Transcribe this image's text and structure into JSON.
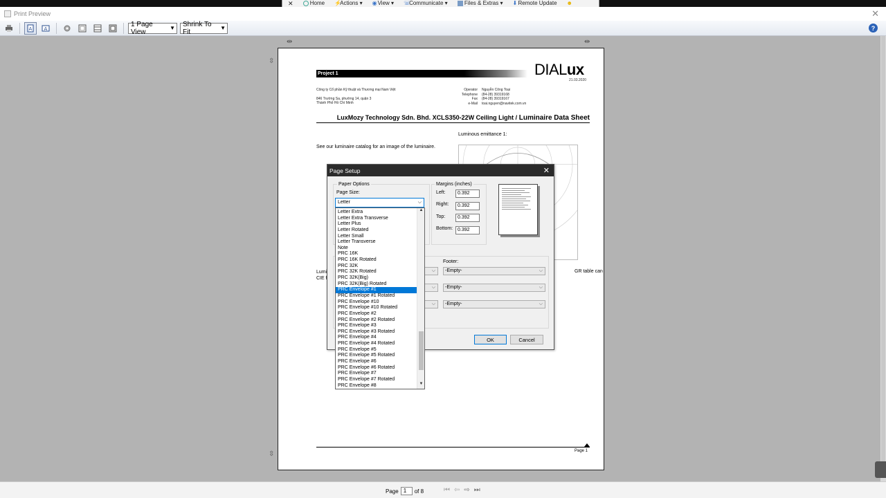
{
  "remote_toolbar": {
    "items": [
      "Home",
      "Actions",
      "View",
      "Communicate",
      "Files & Extras",
      "Remote Update"
    ]
  },
  "window": {
    "title": "Print Preview"
  },
  "toolbar": {
    "page_view": "1 Page View",
    "fit_mode": "Shrink To Fit",
    "help_label": "?"
  },
  "document": {
    "project_label": "Project 1",
    "logo_text": "DIAL",
    "logo_bold": "ux",
    "date": "21.03.2020",
    "company": "Công ty Cổ phần Kỹ thuật và Thương mại Nam Việt",
    "address_line1": "846 Trường Sa, phường 14, quận 3",
    "address_line2": "Thành Phố Hồ Chí Minh",
    "contact_labels": [
      "Operator",
      "Telephone",
      "Fax",
      "e-Mail"
    ],
    "contact_values": [
      "Nguyễn Công Toại",
      "(84-28) 39319168",
      "(84-28) 39319167",
      "toai.nguyen@navitek.com.vn"
    ],
    "heading": "LuxMozy Technology Sdn. Bhd. XCLS350-22W Ceiling Light /",
    "heading_tail": "Luminaire Data Sheet",
    "luminous_label": "Luminous emittance 1:",
    "see_catalog": "See our luminaire catalog for an image of the luminaire.",
    "left_fragment_1": "Lumi",
    "left_fragment_2": "CIE f",
    "right_fragment": "GR table can",
    "page_label": "Page 1"
  },
  "page_setup": {
    "title": "Page Setup",
    "paper_options": "Paper Options",
    "page_size_label": "Page Size:",
    "page_size_value": "Letter",
    "margins_label": "Margins (inches)",
    "margins": {
      "left_label": "Left:",
      "left": "0.392",
      "right_label": "Right:",
      "right": "0.392",
      "top_label": "Top:",
      "top": "0.392",
      "bottom_label": "Bottom:",
      "bottom": "0.392"
    },
    "footer_label": "Footer:",
    "header_values": [
      "",
      "",
      ""
    ],
    "footer_values": [
      "-Empty-",
      "-Empty-",
      "-Empty-"
    ],
    "ok": "OK",
    "cancel": "Cancel",
    "paper_sizes": [
      "Letter Extra",
      "Letter Extra Transverse",
      "Letter Plus",
      "Letter Rotated",
      "Letter Small",
      "Letter Transverse",
      "Note",
      "PRC 16K",
      "PRC 16K Rotated",
      "PRC 32K",
      "PRC 32K Rotated",
      "PRC 32K(Big)",
      "PRC 32K(Big) Rotated",
      "PRC Envelope #1",
      "PRC Envelope #1 Rotated",
      "PRC Envelope #10",
      "PRC Envelope #10 Rotated",
      "PRC Envelope #2",
      "PRC Envelope #2 Rotated",
      "PRC Envelope #3",
      "PRC Envelope #3 Rotated",
      "PRC Envelope #4",
      "PRC Envelope #4 Rotated",
      "PRC Envelope #5",
      "PRC Envelope #5 Rotated",
      "PRC Envelope #6",
      "PRC Envelope #6 Rotated",
      "PRC Envelope #7",
      "PRC Envelope #7 Rotated",
      "PRC Envelope #8"
    ],
    "selected_paper": "PRC Envelope #1"
  },
  "statusbar": {
    "page_label": "Page",
    "page_value": "1",
    "of_label": "of 8"
  }
}
